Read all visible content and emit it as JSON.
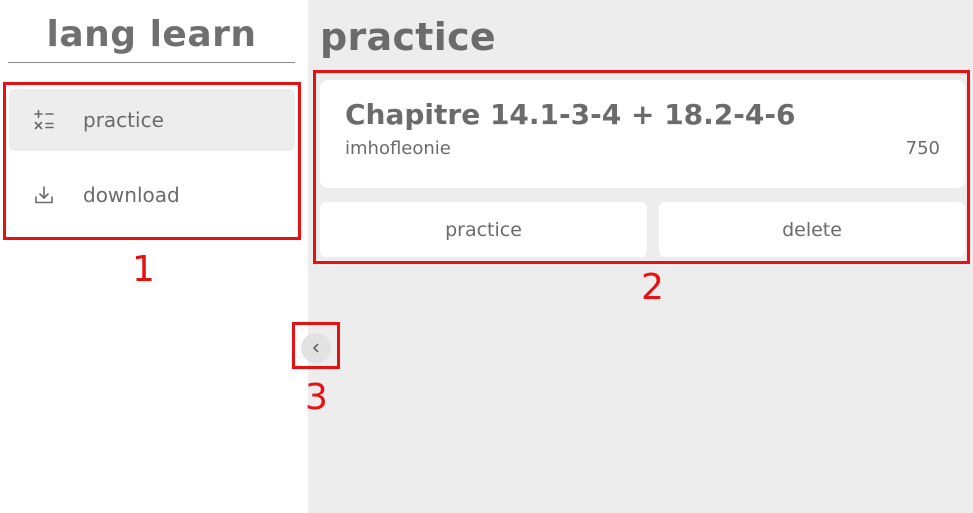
{
  "sidebar": {
    "app_title": "lang learn",
    "items": [
      {
        "label": "practice",
        "icon": "calculator-ops-icon",
        "active": true
      },
      {
        "label": "download",
        "icon": "download-icon",
        "active": false
      }
    ],
    "collapse_icon": "chevron-left-icon"
  },
  "main": {
    "page_title": "practice",
    "card": {
      "title": "Chapitre 14.1-3-4 + 18.2-4-6",
      "author": "imhofleonie",
      "count": "750"
    },
    "actions": {
      "practice_label": "practice",
      "delete_label": "delete"
    }
  },
  "annotations": {
    "labels": [
      "1",
      "2",
      "3"
    ],
    "color": "#e81010"
  },
  "colors": {
    "background": "#ededed",
    "panel": "#ffffff",
    "text": "#6b6b6b"
  }
}
